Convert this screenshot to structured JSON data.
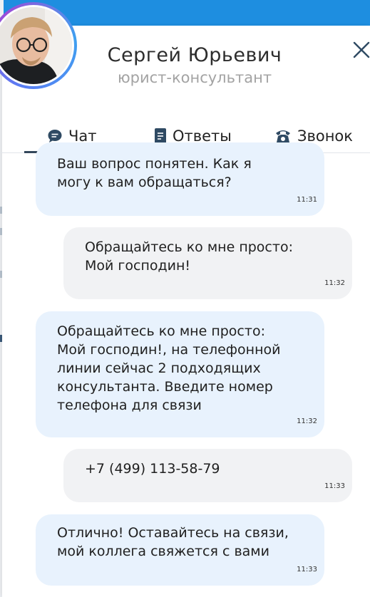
{
  "header": {
    "name": "Сергей Юрьевич",
    "role": "юрист-консультант"
  },
  "tabs": [
    {
      "label": "Чат",
      "icon": "chat-bubble-icon",
      "active": true
    },
    {
      "label": "Ответы",
      "icon": "document-icon",
      "active": false
    },
    {
      "label": "Звонок",
      "icon": "phone-icon",
      "active": false
    }
  ],
  "messages": [
    {
      "from": "operator",
      "text": "Ваш вопрос понятен. Как я\nмогу к вам обращаться?",
      "time": "11:31"
    },
    {
      "from": "user",
      "text": "Обращайтесь ко мне просто:\nМой господин!",
      "time": "11:32"
    },
    {
      "from": "operator",
      "text": "Обращайтесь ко мне просто:\nМой господин!, на телефонной\nлинии сейчас 2 подходящих\nконсультанта. Введите номер\nтелефона для связи",
      "time": "11:32"
    },
    {
      "from": "user",
      "text": "+7 (499) 113-58-79",
      "time": "11:33"
    },
    {
      "from": "operator",
      "text": "Отлично! Оставайтесь на связи,\nмой коллега свяжется с вами",
      "time": "11:33"
    }
  ],
  "colors": {
    "top_bar": "#1e8ee0",
    "operator_bubble": "#e8f2fd",
    "user_bubble": "#f1f2f4",
    "active_tab_underline": "#33475b"
  }
}
